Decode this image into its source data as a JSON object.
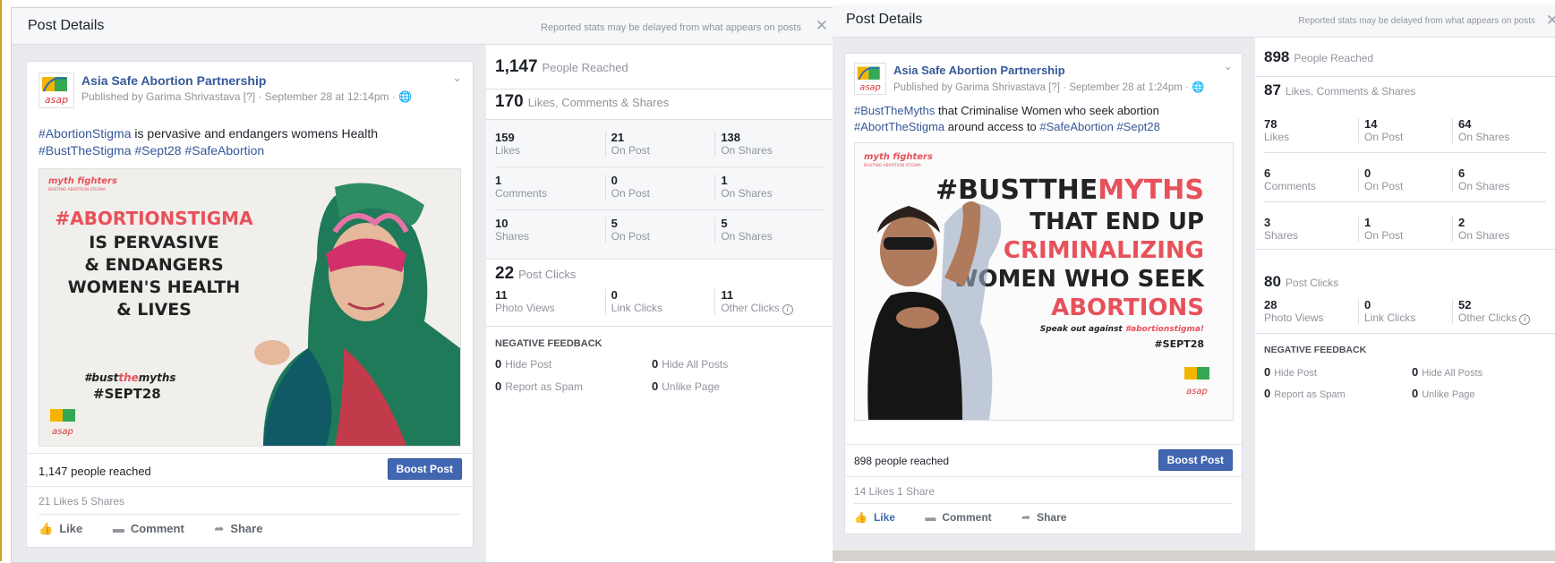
{
  "panels": [
    {
      "header": {
        "title": "Post Details",
        "note": "Reported stats may be delayed from what appears on posts"
      },
      "post": {
        "page_name": "Asia Safe Abortion Partnership",
        "published_by": "Published by Garima Shrivastava [?] · September 28 at 12:14pm · ",
        "text_line1": [
          {
            "t": "#AbortionStigma",
            "hash": true
          },
          {
            "t": " is pervasive and endangers womens Health",
            "hash": false
          }
        ],
        "text_line2": [
          {
            "t": "#BustTheStigma",
            "hash": true
          },
          {
            "t": " ",
            "hash": false
          },
          {
            "t": "#Sept28",
            "hash": true
          },
          {
            "t": " ",
            "hash": false
          },
          {
            "t": "#SafeAbortion",
            "hash": true
          }
        ],
        "image": {
          "brand": "myth fighters",
          "brand_sub": "BUSTING ABORTION STIGMA",
          "headline": "#ABORTIONSTIGMA",
          "body_lines": [
            "IS PERVASIVE",
            "& ENDANGERS",
            "WOMEN'S HEALTH",
            "& LIVES"
          ],
          "tag_pre": "#bust",
          "tag_mid": "the",
          "tag_post": "myths",
          "date_tag": "#SEPT28",
          "logo_text": "asap"
        },
        "reach_text": "1,147 people reached",
        "boost_label": "Boost Post",
        "likes_shares": "21 Likes   5 Shares",
        "actions": {
          "like": "Like",
          "comment": "Comment",
          "share": "Share"
        }
      },
      "stats": {
        "reached": {
          "value": "1,147",
          "label": "People Reached"
        },
        "engagement": {
          "value": "170",
          "label": "Likes, Comments & Shares"
        },
        "rows": [
          [
            {
              "v": "159",
              "l": "Likes"
            },
            {
              "v": "21",
              "l": "On Post"
            },
            {
              "v": "138",
              "l": "On Shares"
            }
          ],
          [
            {
              "v": "1",
              "l": "Comments"
            },
            {
              "v": "0",
              "l": "On Post"
            },
            {
              "v": "1",
              "l": "On Shares"
            }
          ],
          [
            {
              "v": "10",
              "l": "Shares"
            },
            {
              "v": "5",
              "l": "On Post"
            },
            {
              "v": "5",
              "l": "On Shares"
            }
          ]
        ],
        "clicks": {
          "value": "22",
          "label": "Post Clicks"
        },
        "click_row": [
          {
            "v": "11",
            "l": "Photo Views"
          },
          {
            "v": "0",
            "l": "Link Clicks"
          },
          {
            "v": "11",
            "l": "Other Clicks"
          }
        ],
        "negative": {
          "title": "NEGATIVE FEEDBACK",
          "items": [
            {
              "v": "0",
              "l": "Hide Post"
            },
            {
              "v": "0",
              "l": "Hide All Posts"
            },
            {
              "v": "0",
              "l": "Report as Spam"
            },
            {
              "v": "0",
              "l": "Unlike Page"
            }
          ]
        }
      }
    },
    {
      "header": {
        "title": "Post Details",
        "note": "Reported stats may be delayed from what appears on posts"
      },
      "post": {
        "page_name": "Asia Safe Abortion Partnership",
        "published_by": "Published by Garima Shrivastava [?] · September 28 at 1:24pm · ",
        "text_line1": [
          {
            "t": "#BustTheMyths",
            "hash": true
          },
          {
            "t": " that Criminalise Women who seek abortion",
            "hash": false
          }
        ],
        "text_line2": [
          {
            "t": "#AbortTheStigma",
            "hash": true
          },
          {
            "t": " around access to ",
            "hash": false
          },
          {
            "t": "#SafeAbortion",
            "hash": true
          },
          {
            "t": " ",
            "hash": false
          },
          {
            "t": "#Sept28",
            "hash": true
          }
        ],
        "image": {
          "brand": "myth fighters",
          "brand_sub": "BUSTING ABORTION STIGMA",
          "h_bust": "#BUST",
          "h_the": "THE",
          "h_myths": "MYTHS",
          "lines": [
            {
              "t": "THAT END UP",
              "red": false
            },
            {
              "t": "CRIMINALIZING",
              "red": true
            },
            {
              "t": "WOMEN WHO SEEK",
              "red": false
            },
            {
              "t": "ABORTIONS",
              "red": true
            }
          ],
          "speak_pre": "Speak out against ",
          "speak_tag": "#abortionstigma!",
          "date_tag": "#SEPT28",
          "logo_text": "asap"
        },
        "reach_text": "898 people reached",
        "boost_label": "Boost Post",
        "likes_shares": "14 Likes   1 Share",
        "actions": {
          "like": "Like",
          "comment": "Comment",
          "share": "Share"
        }
      },
      "stats": {
        "reached": {
          "value": "898",
          "label": "People Reached"
        },
        "engagement": {
          "value": "87",
          "label": "Likes, Comments & Shares"
        },
        "rows": [
          [
            {
              "v": "78",
              "l": "Likes"
            },
            {
              "v": "14",
              "l": "On Post"
            },
            {
              "v": "64",
              "l": "On Shares"
            }
          ],
          [
            {
              "v": "6",
              "l": "Comments"
            },
            {
              "v": "0",
              "l": "On Post"
            },
            {
              "v": "6",
              "l": "On Shares"
            }
          ],
          [
            {
              "v": "3",
              "l": "Shares"
            },
            {
              "v": "1",
              "l": "On Post"
            },
            {
              "v": "2",
              "l": "On Shares"
            }
          ]
        ],
        "clicks": {
          "value": "80",
          "label": "Post Clicks"
        },
        "click_row": [
          {
            "v": "28",
            "l": "Photo Views"
          },
          {
            "v": "0",
            "l": "Link Clicks"
          },
          {
            "v": "52",
            "l": "Other Clicks"
          }
        ],
        "negative": {
          "title": "NEGATIVE FEEDBACK",
          "items": [
            {
              "v": "0",
              "l": "Hide Post"
            },
            {
              "v": "0",
              "l": "Hide All Posts"
            },
            {
              "v": "0",
              "l": "Report as Spam"
            },
            {
              "v": "0",
              "l": "Unlike Page"
            }
          ]
        }
      }
    }
  ],
  "colors": {
    "link": "#365899",
    "boost": "#4267b2",
    "muted": "#90949c",
    "like_active": "#4267b2",
    "poster_red": "#e8515a"
  },
  "icons": {
    "close": "close-icon",
    "globe": "globe-icon",
    "chevron": "chevron-down-icon",
    "like": "thumbs-up-icon",
    "comment": "comment-icon",
    "share": "share-arrow-icon",
    "info": "info-icon"
  }
}
